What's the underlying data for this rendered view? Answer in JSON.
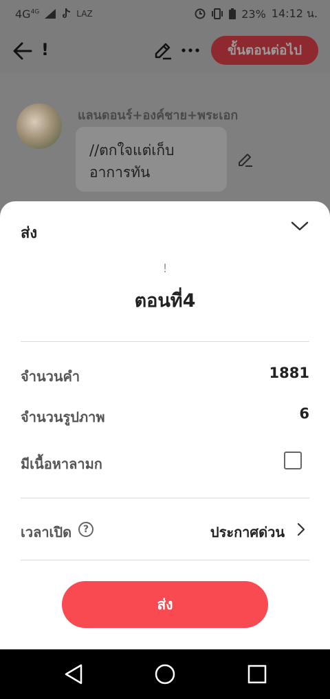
{
  "status_bar": {
    "network": "4G",
    "network_sup": "4G",
    "app_label": "LAZ",
    "battery": "23%",
    "time": "14:12 น."
  },
  "top_bar": {
    "title": "!",
    "next_button": "ขั้นตอนต่อไป"
  },
  "chat": {
    "character_name": "แลนดอนร์+องค์ชาย+พระเอก",
    "message": "//ตกใจแต่เก็บอาการทัน"
  },
  "sheet": {
    "title": "ส่ง",
    "draft_label": "!",
    "episode_title": "ตอนที่4",
    "rows": {
      "word_count_label": "จำนวนคำ",
      "word_count_value": "1881",
      "image_count_label": "จำนวนรูปภาพ",
      "image_count_value": "6",
      "mature_label": "มีเนื้อหาลามก",
      "publish_time_label": "เวลาเปิด",
      "publish_time_value": "ประกาศด่วน",
      "help_symbol": "?"
    },
    "submit_button": "ส่ง"
  },
  "colors": {
    "accent": "#fa4a51",
    "dim_overlay": "#7f7f7f"
  },
  "icons": [
    "back-arrow-icon",
    "pencil-icon",
    "more-icon",
    "chevron-down-icon",
    "question-icon",
    "chevron-right-icon",
    "nav-back-icon",
    "nav-home-icon",
    "nav-recent-icon"
  ]
}
